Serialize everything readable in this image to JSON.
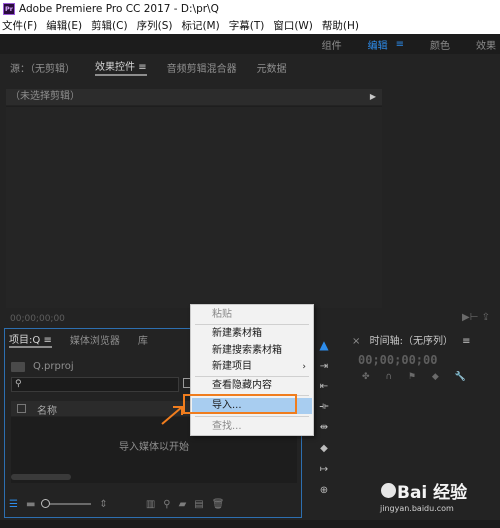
{
  "app": {
    "title": "Adobe Premiere Pro CC 2017 - D:\\pr\\Q",
    "icon_text": "Pr"
  },
  "menubar": [
    "文件(F)",
    "编辑(E)",
    "剪辑(C)",
    "序列(S)",
    "标记(M)",
    "字幕(T)",
    "窗口(W)",
    "帮助(H)"
  ],
  "workspaces": {
    "items": [
      "组件",
      "编辑",
      "颜色",
      "效果"
    ],
    "active": "编辑",
    "menu_icon": "≡"
  },
  "source_panel": {
    "tabs": [
      "源：（无剪辑）",
      "效果控件",
      "音频剪辑混合器",
      "元数据"
    ],
    "active_tab": "效果控件",
    "tab_menu_icon": "≡",
    "clip_header": "（未选择剪辑）",
    "timecode": "00;00;00;00"
  },
  "project_panel": {
    "tabs": [
      "项目:Q",
      "媒体浏览器",
      "库"
    ],
    "tab_menu_icon": "≡",
    "file_name": "Q.prproj",
    "search_placeholder": "",
    "column_name": "名称",
    "empty_message": "导入媒体以开始"
  },
  "timeline_panel": {
    "tab": "时间轴:（无序列）",
    "tab_menu_icon": "≡",
    "timecode": "00;00;00;00"
  },
  "context_menu": {
    "items": [
      "粘贴",
      "新建素材箱",
      "新建搜索素材箱",
      "新建项目",
      "查看隐藏内容",
      "导入...",
      "查找..."
    ],
    "disabled": [
      "粘贴",
      "查找..."
    ],
    "highlighted": "导入...",
    "submenu_arrow": "›"
  },
  "watermark": {
    "brand": "Bai 经验",
    "url": "jingyan.baidu.com"
  },
  "colors": {
    "accent_blue": "#2d8ceb",
    "highlight_orange": "#f07d1e",
    "menu_highlight": "#a8cdf0"
  }
}
